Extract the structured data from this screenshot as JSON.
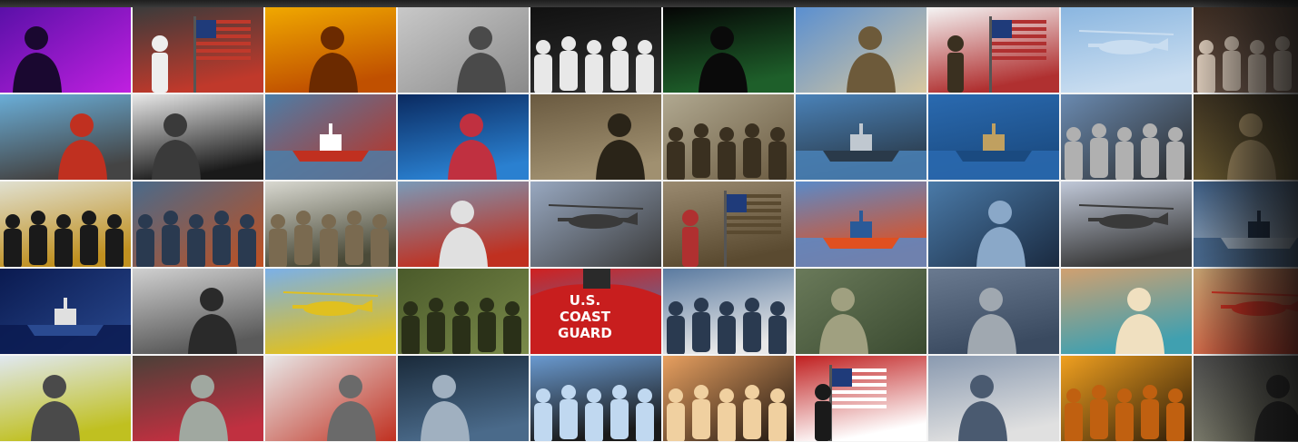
{
  "gallery": {
    "rows": 5,
    "columns": 10,
    "tiles": [
      {
        "subject": "dancer-neon-stage",
        "colors": [
          "#5a10a8",
          "#c020e0",
          "#1a0830"
        ],
        "fig": "person"
      },
      {
        "subject": "color-guard-flags",
        "colors": [
          "#3b3b3b",
          "#c0392b",
          "#eeeeee"
        ],
        "fig": "flag"
      },
      {
        "subject": "welder-sparks",
        "colors": [
          "#f0a800",
          "#c05000",
          "#6b2a00"
        ],
        "fig": "person"
      },
      {
        "subject": "airman-at-computer",
        "colors": [
          "#c8c8c8",
          "#8a8a8a",
          "#4a4a4a"
        ],
        "fig": "person"
      },
      {
        "subject": "honor-guard-night",
        "colors": [
          "#111111",
          "#2a2a2a",
          "#e8e8e8"
        ],
        "fig": "group"
      },
      {
        "subject": "soldier-night-radio",
        "colors": [
          "#050505",
          "#1e5f2a",
          "#0a0a0a"
        ],
        "fig": "person"
      },
      {
        "subject": "soldier-goggles",
        "colors": [
          "#5a8fd0",
          "#d8c8a0",
          "#6d5a3a"
        ],
        "fig": "person"
      },
      {
        "subject": "soldiers-american-flag",
        "colors": [
          "#f4f4f4",
          "#b03030",
          "#3a3020"
        ],
        "fig": "flag"
      },
      {
        "subject": "osprey-aircraft",
        "colors": [
          "#8ab6e0",
          "#c9ddf0",
          "#2a2a2a"
        ],
        "fig": "aircraft"
      },
      {
        "subject": "medical-team",
        "colors": [
          "#3a2a20",
          "#8a7060",
          "#d0c0b0"
        ],
        "fig": "group"
      },
      {
        "subject": "sailor-ship-deck",
        "colors": [
          "#6aaed8",
          "#444444",
          "#c03020"
        ],
        "fig": "person"
      },
      {
        "subject": "binoculars-lookout",
        "colors": [
          "#e8e8e8",
          "#1a1a1a",
          "#3a3a3a"
        ],
        "fig": "person"
      },
      {
        "subject": "coast-guard-boat",
        "colors": [
          "#4c7ea8",
          "#c03020",
          "#ffffff"
        ],
        "fig": "ship"
      },
      {
        "subject": "cockpit-blue-lights",
        "colors": [
          "#0a2a60",
          "#2a80d0",
          "#c03040"
        ],
        "fig": "person"
      },
      {
        "subject": "soldier-in-doorway",
        "colors": [
          "#6a5a40",
          "#a09070",
          "#2a2418"
        ],
        "fig": "person"
      },
      {
        "subject": "troops-helicopter",
        "colors": [
          "#b0a890",
          "#6a5a40",
          "#3a3020"
        ],
        "fig": "group"
      },
      {
        "subject": "sailors-pier",
        "colors": [
          "#4a82b8",
          "#2a3a4a",
          "#c0c8d0"
        ],
        "fig": "ship"
      },
      {
        "subject": "rigid-inflatable-boat",
        "colors": [
          "#2a6ab0",
          "#1a4a80",
          "#c0a060"
        ],
        "fig": "ship"
      },
      {
        "subject": "sailors-carrier",
        "colors": [
          "#6a8ab0",
          "#2a2a2a",
          "#b0b0b0"
        ],
        "fig": "group"
      },
      {
        "subject": "marine-binoculars",
        "colors": [
          "#3a3020",
          "#6a5a30",
          "#a08a60"
        ],
        "fig": "person"
      },
      {
        "subject": "marine-band-parade",
        "colors": [
          "#e0e0d0",
          "#c09020",
          "#1a1a1a"
        ],
        "fig": "group"
      },
      {
        "subject": "deck-crew-rescue",
        "colors": [
          "#4a6a8a",
          "#c05020",
          "#2a3a50"
        ],
        "fig": "group"
      },
      {
        "subject": "soldiers-training",
        "colors": [
          "#d8d8d0",
          "#4a4a38",
          "#7a6a50"
        ],
        "fig": "group"
      },
      {
        "subject": "rescue-swimmer-deck",
        "colors": [
          "#7a9ab8",
          "#c03020",
          "#e0e0e0"
        ],
        "fig": "person"
      },
      {
        "subject": "helicopter-hoist",
        "colors": [
          "#98a8c0",
          "#3a3a3a",
          "#6a6a6a"
        ],
        "fig": "aircraft"
      },
      {
        "subject": "soldier-flag-horizon",
        "colors": [
          "#9a8a70",
          "#5a4a30",
          "#b03030"
        ],
        "fig": "flag"
      },
      {
        "subject": "coast-guard-cutter",
        "colors": [
          "#5a8ac8",
          "#e05020",
          "#2a5a98"
        ],
        "fig": "ship"
      },
      {
        "subject": "sailor-binoculars-sea",
        "colors": [
          "#4a7aa8",
          "#1a2a40",
          "#8aa8c8"
        ],
        "fig": "person"
      },
      {
        "subject": "apache-helicopter",
        "colors": [
          "#c0c8d8",
          "#3a3a3a",
          "#8a98b0"
        ],
        "fig": "aircraft"
      },
      {
        "subject": "navy-ships-formation",
        "colors": [
          "#3a5a80",
          "#9aaabb",
          "#1a2a40"
        ],
        "fig": "ship"
      },
      {
        "subject": "ship-in-storm",
        "colors": [
          "#0a1a50",
          "#2a4a90",
          "#e0e0e0"
        ],
        "fig": "ship"
      },
      {
        "subject": "camera-operator",
        "colors": [
          "#d0d0d0",
          "#5a5a5a",
          "#2a2a2a"
        ],
        "fig": "person"
      },
      {
        "subject": "flight-deck-helicopter",
        "colors": [
          "#7ab0e8",
          "#e0c020",
          "#2a2a2a"
        ],
        "fig": "aircraft"
      },
      {
        "subject": "soldiers-jungle",
        "colors": [
          "#4a5a2a",
          "#7a8a4a",
          "#2a3018"
        ],
        "fig": "group"
      },
      {
        "subject": "coast-guard-jacket",
        "colors": [
          "#d02020",
          "#4a7ab0",
          "#ffffff"
        ],
        "fig": "text"
      },
      {
        "subject": "sailors-dress-whites",
        "colors": [
          "#5a7aa0",
          "#e8e8e8",
          "#2a3a50"
        ],
        "fig": "group"
      },
      {
        "subject": "soldier-helmet-portrait",
        "colors": [
          "#6a7a5a",
          "#3a4a30",
          "#a0a080"
        ],
        "fig": "person"
      },
      {
        "subject": "soldier-saluting",
        "colors": [
          "#6a7a90",
          "#3a4a60",
          "#a0a8b0"
        ],
        "fig": "person"
      },
      {
        "subject": "medic-with-child",
        "colors": [
          "#d0a070",
          "#40a0b0",
          "#f0e0c0"
        ],
        "fig": "person"
      },
      {
        "subject": "red-helicopter-desert",
        "colors": [
          "#c0a070",
          "#d03020",
          "#8a6a40"
        ],
        "fig": "aircraft"
      },
      {
        "subject": "sailor-yellow-vest",
        "colors": [
          "#e0e8f0",
          "#c0c020",
          "#4a4a4a"
        ],
        "fig": "person"
      },
      {
        "subject": "medic-in-ambulance",
        "colors": [
          "#4a4038",
          "#c03040",
          "#a0a8a0"
        ],
        "fig": "person"
      },
      {
        "subject": "mechanic-repair",
        "colors": [
          "#e8e8e8",
          "#c03020",
          "#6a6a6a"
        ],
        "fig": "person"
      },
      {
        "subject": "pilot-in-cockpit",
        "colors": [
          "#1a2a3a",
          "#4a6a8a",
          "#a0b0c0"
        ],
        "fig": "person"
      },
      {
        "subject": "paratroopers-jump",
        "colors": [
          "#6a9ad0",
          "#1a1a1a",
          "#c0d8f0"
        ],
        "fig": "group"
      },
      {
        "subject": "sunset-silhouettes",
        "colors": [
          "#e8a060",
          "#1a1410",
          "#f0d0a0"
        ],
        "fig": "group"
      },
      {
        "subject": "flag-silhouette",
        "colors": [
          "#c02020",
          "#ffffff",
          "#1a1a1a"
        ],
        "fig": "flag"
      },
      {
        "subject": "elder-with-sailors",
        "colors": [
          "#8a9ab0",
          "#e0e0e0",
          "#4a5a70"
        ],
        "fig": "person"
      },
      {
        "subject": "golden-sunset-crew",
        "colors": [
          "#f0a020",
          "#2a1a08",
          "#c06010"
        ],
        "fig": "group"
      },
      {
        "subject": "soldier-gas-mask",
        "colors": [
          "#4a4a4a",
          "#7a7a6a",
          "#2a2a2a"
        ],
        "fig": "person"
      }
    ]
  },
  "overlay_texts": {
    "jacket_line1": "U.S.",
    "jacket_line2": "COAST",
    "jacket_line3": "GUARD"
  }
}
